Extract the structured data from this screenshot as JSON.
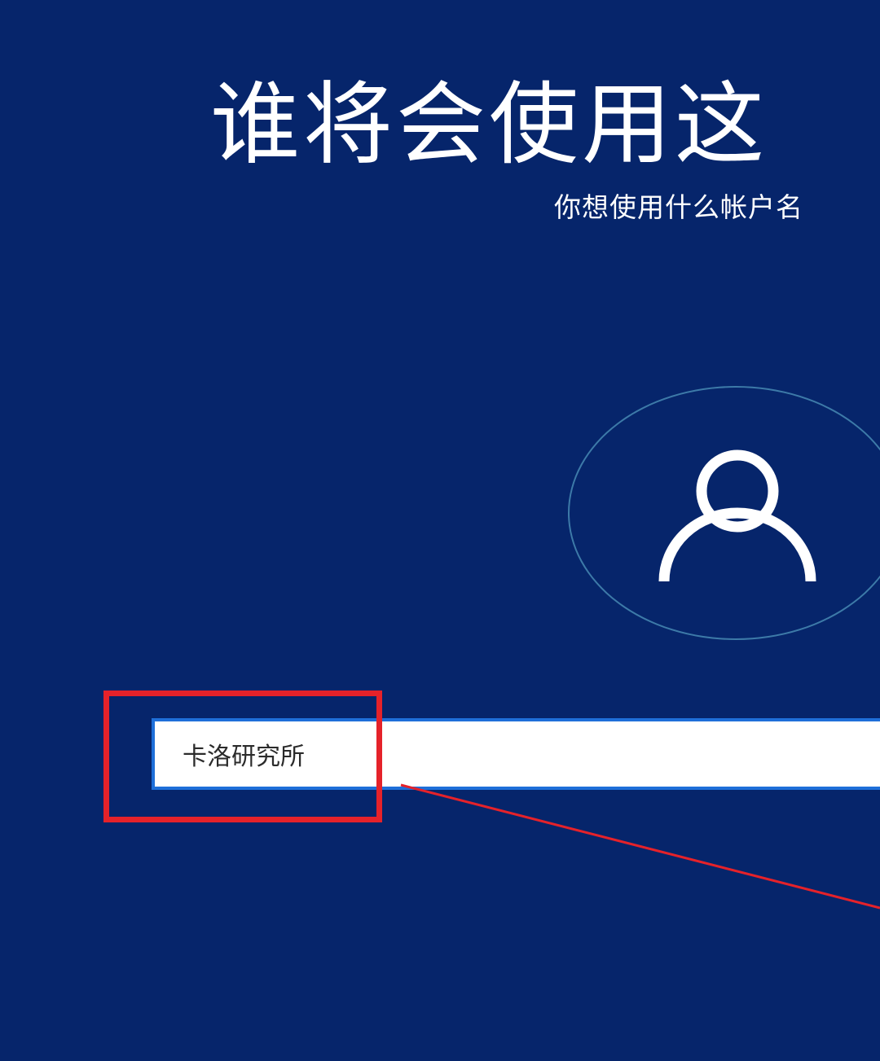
{
  "setup": {
    "title": "谁将会使用这",
    "subtitle": "你想使用什么帐户名",
    "account_name_value": "卡洛研究所"
  },
  "annotation": {
    "highlight_color": "#e5222a"
  },
  "theme": {
    "background": "#06256b",
    "input_border": "#1e6fd9"
  },
  "icons": {
    "avatar": "user-icon"
  }
}
